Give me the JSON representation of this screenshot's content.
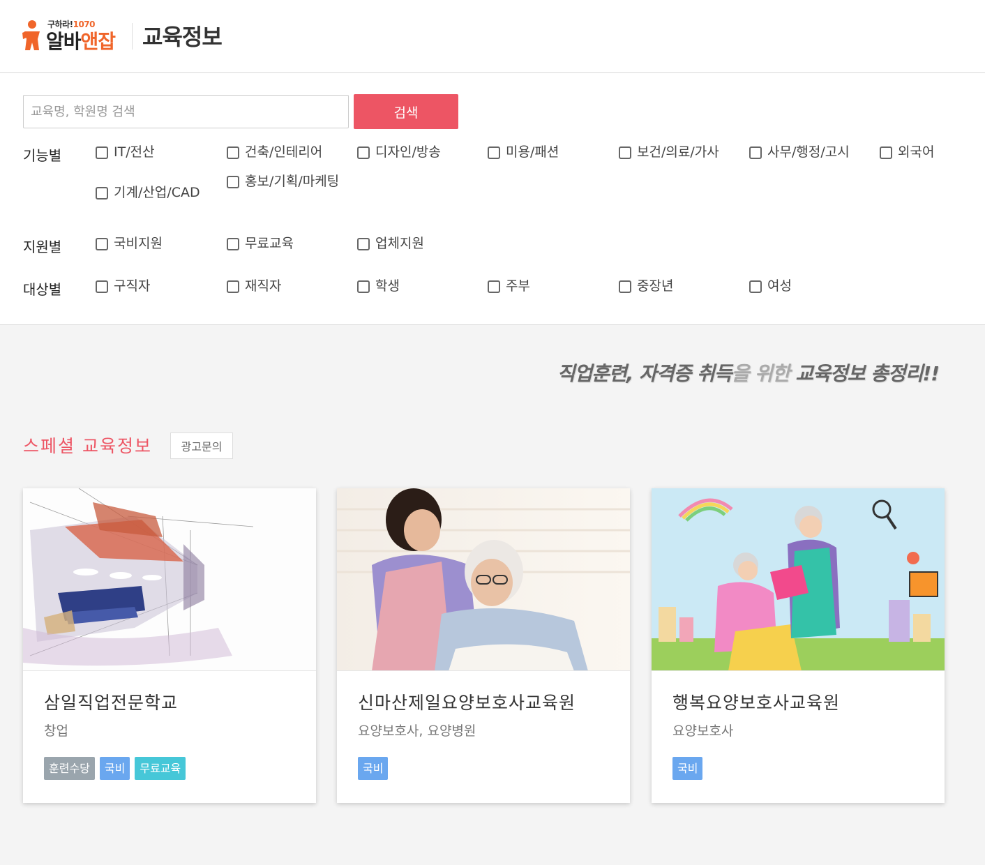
{
  "header": {
    "logo_small_prefix": "구하라!",
    "logo_small_num": "1070",
    "logo_main_dark": "알바",
    "logo_main_orange": "앤잡",
    "title": "교육정보"
  },
  "search": {
    "placeholder": "교육명, 학원명 검색",
    "button_label": "검색"
  },
  "filters": {
    "function": {
      "label": "기능별",
      "options": [
        "IT/전산",
        "건축/인테리어",
        "디자인/방송",
        "미용/패션",
        "보건/의료/가사",
        "사무/행정/고시",
        "외국어",
        "기계/산업/CAD",
        "홍보/기획/마케팅"
      ]
    },
    "support": {
      "label": "지원별",
      "options": [
        "국비지원",
        "무료교육",
        "업체지원"
      ]
    },
    "target": {
      "label": "대상별",
      "options": [
        "구직자",
        "재직자",
        "학생",
        "주부",
        "중장년",
        "여성"
      ]
    }
  },
  "banner": {
    "part1": "직업훈련, 자격증 취득",
    "part2": "을 위한",
    "part3": " 교육정보 총정리!!"
  },
  "special": {
    "title": "스페셜 교육정보",
    "ad_label": "광고문의"
  },
  "cards": [
    {
      "name": "삼일직업전문학교",
      "sub": "창업",
      "tags": [
        {
          "label": "훈련수당",
          "color": "#9aa5ad"
        },
        {
          "label": "국비",
          "color": "#6aa7ef"
        },
        {
          "label": "무료교육",
          "color": "#46c7d8"
        }
      ]
    },
    {
      "name": "신마산제일요양보호사교육원",
      "sub": "요양보호사, 요양병원",
      "tags": [
        {
          "label": "국비",
          "color": "#6aa7ef"
        }
      ]
    },
    {
      "name": "행복요양보호사교육원",
      "sub": "요양보호사",
      "tags": [
        {
          "label": "국비",
          "color": "#6aa7ef"
        }
      ]
    }
  ],
  "colors": {
    "accent": "#ed5564",
    "brand_orange": "#f0652a"
  }
}
